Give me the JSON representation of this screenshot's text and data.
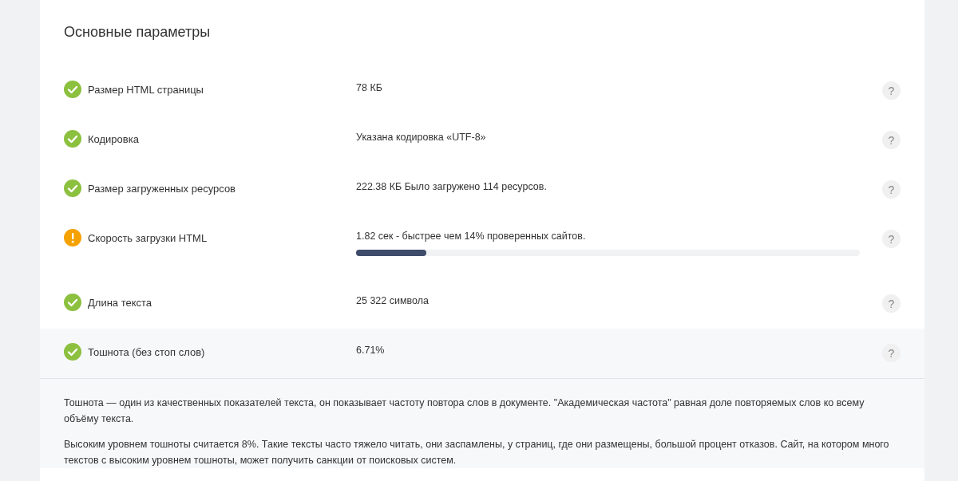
{
  "section": {
    "title": "Основные параметры"
  },
  "rows": [
    {
      "label": "Размер HTML страницы",
      "value": "78 КБ",
      "kind": "ok",
      "help": "?",
      "expanded": false
    },
    {
      "label": "Кодировка",
      "value": "Указана кодировка «UTF-8»",
      "kind": "ok",
      "help": "?",
      "expanded": false
    },
    {
      "label": "Размер загруженных ресурсов",
      "value": "222.38 КБ Было загружено 114 ресурсов.",
      "kind": "ok",
      "help": "?",
      "expanded": false
    },
    {
      "label": "Скорость загрузки HTML",
      "value": "1.82 сек - быстрее чем 14% проверенных сайтов.",
      "kind": "warning",
      "help": "?",
      "expanded": false,
      "level": 0.14
    },
    {
      "label": "Длина текста",
      "value": "25 322 символа",
      "kind": "ok",
      "help": "?",
      "expanded": false
    },
    {
      "label": "Тошнота (без стоп слов)",
      "value": "6.71%",
      "kind": "ok",
      "help": "?",
      "expanded": true,
      "details": [
        "Тошнота — один из качественных показателей текста, он показывает частоту повтора слов в документе. \"Академическая частота\" равная доле повторяемых слов ко всему объёму текста.",
        "Высоким уровнем тошноты считается 8%. Такие тексты часто тяжело читать, они заспамлены, у страниц, где они размещены, большой процент отказов. Сайт, на котором много текстов с высоким уровнем тошноты, может получить санкции от поисковых систем."
      ]
    }
  ]
}
